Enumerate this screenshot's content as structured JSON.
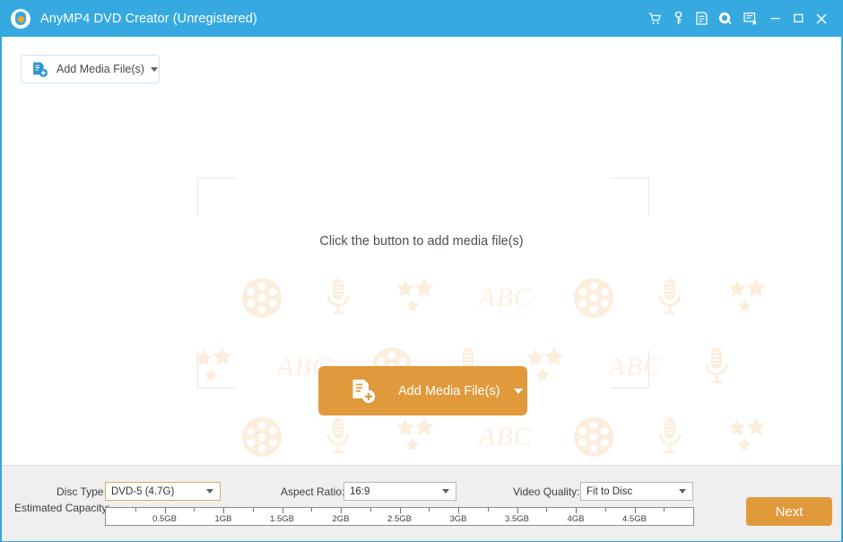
{
  "window": {
    "title": "AnyMP4 DVD Creator (Unregistered)",
    "logo_icon": "anymp4-logo-icon",
    "accent_color": "#36a9e1",
    "orange_color": "#e09a3c",
    "controls": [
      {
        "name": "cart-icon",
        "tooltip": "Buy"
      },
      {
        "name": "key-icon",
        "tooltip": "Register"
      },
      {
        "name": "document-icon",
        "tooltip": "Log"
      },
      {
        "name": "help-icon",
        "tooltip": "Help"
      },
      {
        "name": "feedback-icon",
        "tooltip": "Feedback"
      },
      {
        "name": "minimize-icon",
        "tooltip": "Minimize"
      },
      {
        "name": "maximize-icon",
        "tooltip": "Maximize"
      },
      {
        "name": "close-icon",
        "tooltip": "Close"
      }
    ]
  },
  "toolbar": {
    "add_media_label": "Add Media File(s)",
    "add_media_icon": "add-file-icon",
    "dropdown_icon": "chevron-down-icon"
  },
  "stage": {
    "hint_text": "Click the button to add media file(s)",
    "add_media_label": "Add Media File(s)",
    "add_media_icon": "add-file-icon",
    "dropdown_icon": "chevron-down-icon",
    "watermark_items": [
      "film-reel",
      "microphone",
      "stars",
      "ABC"
    ],
    "watermark_text": "ABC"
  },
  "bottom": {
    "disc_type_label": "Disc Type",
    "disc_type_value": "DVD-5 (4.7G)",
    "aspect_ratio_label": "Aspect Ratio:",
    "aspect_ratio_value": "16:9",
    "video_quality_label": "Video Quality:",
    "video_quality_value": "Fit to Disc",
    "capacity_label": "Estimated Capacity:",
    "capacity_ticks": [
      "0.5GB",
      "1GB",
      "1.5GB",
      "2GB",
      "2.5GB",
      "3GB",
      "3.5GB",
      "4GB",
      "4.5GB"
    ],
    "next_label": "Next"
  }
}
